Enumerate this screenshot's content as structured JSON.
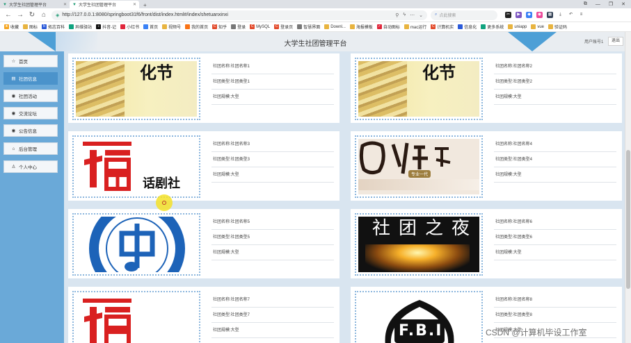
{
  "browser": {
    "tabs": [
      {
        "title": "大学生社团管理平台",
        "active": false
      },
      {
        "title": "大学生社团管理平台",
        "active": true
      }
    ],
    "url": "http://127.0.0.1:8080/springboot31f6/front/dist/index.html#/index/shetuanxinxi",
    "search_placeholder": "点此搜索",
    "bookmarks": [
      "收藏",
      "图标",
      "拓志百科",
      "异维驿站",
      "抖音-记",
      "小红书",
      "首页",
      "视频号",
      "我的首页",
      "知乎",
      "登录",
      "MySQL",
      "登录页",
      "智慧界面",
      "Downl...",
      "海报模板",
      "自动图标",
      "mac运行",
      "计算机实",
      "信息化",
      "更多系统",
      "uniapp",
      "vue",
      "验证码"
    ]
  },
  "header": {
    "title": "大学生社团管理平台",
    "user": "用户账号1",
    "logout_label": "退出"
  },
  "sidebar": {
    "items": [
      {
        "icon": "☆",
        "label": "首页",
        "active": false
      },
      {
        "icon": "▤",
        "label": "社团信息",
        "active": true
      },
      {
        "icon": "◉",
        "label": "社团活动",
        "active": false
      },
      {
        "icon": "◉",
        "label": "交流论坛",
        "active": false
      },
      {
        "icon": "◉",
        "label": "公告信息",
        "active": false
      },
      {
        "icon": "⌂",
        "label": "后台管理",
        "active": false
      },
      {
        "icon": "♙",
        "label": "个人中心",
        "active": false
      }
    ]
  },
  "cards": [
    {
      "name": "社团名称:社团名称1",
      "type": "社团类型:社团类型1",
      "size": "社团规模:大型",
      "img_text": "化节"
    },
    {
      "name": "社团名称:社团名称2",
      "type": "社团类型:社团类型2",
      "size": "社团规模:大型",
      "img_text": "化节"
    },
    {
      "name": "社团名称:社团名称3",
      "type": "社团类型:社团类型3",
      "size": "社团规模:大型",
      "img_text": "话剧社"
    },
    {
      "name": "社团名称:社团名称4",
      "type": "社团类型:社团类型4",
      "size": "社团规模:大型",
      "img_text": "专业一代"
    },
    {
      "name": "社团名称:社团名称5",
      "type": "社团类型:社团类型5",
      "size": "社团规模:大型",
      "img_text": ""
    },
    {
      "name": "社团名称:社团名称6",
      "type": "社团类型:社团类型6",
      "size": "社团规模:大型",
      "img_text": "社团之夜"
    },
    {
      "name": "社团名称:社团名称7",
      "type": "社团类型:社团类型7",
      "size": "社团规模:大型",
      "img_text": ""
    },
    {
      "name": "社团名称:社团名称8",
      "type": "社团类型:社团类型8",
      "size": "社团规模:大型",
      "img_text": "F.B.I"
    }
  ],
  "watermark": "CSDN @计算机毕设工作室",
  "colors": {
    "accent": "#4b93cb",
    "sidebar": "#6aa9d8",
    "frame": "#8bb6dd"
  }
}
